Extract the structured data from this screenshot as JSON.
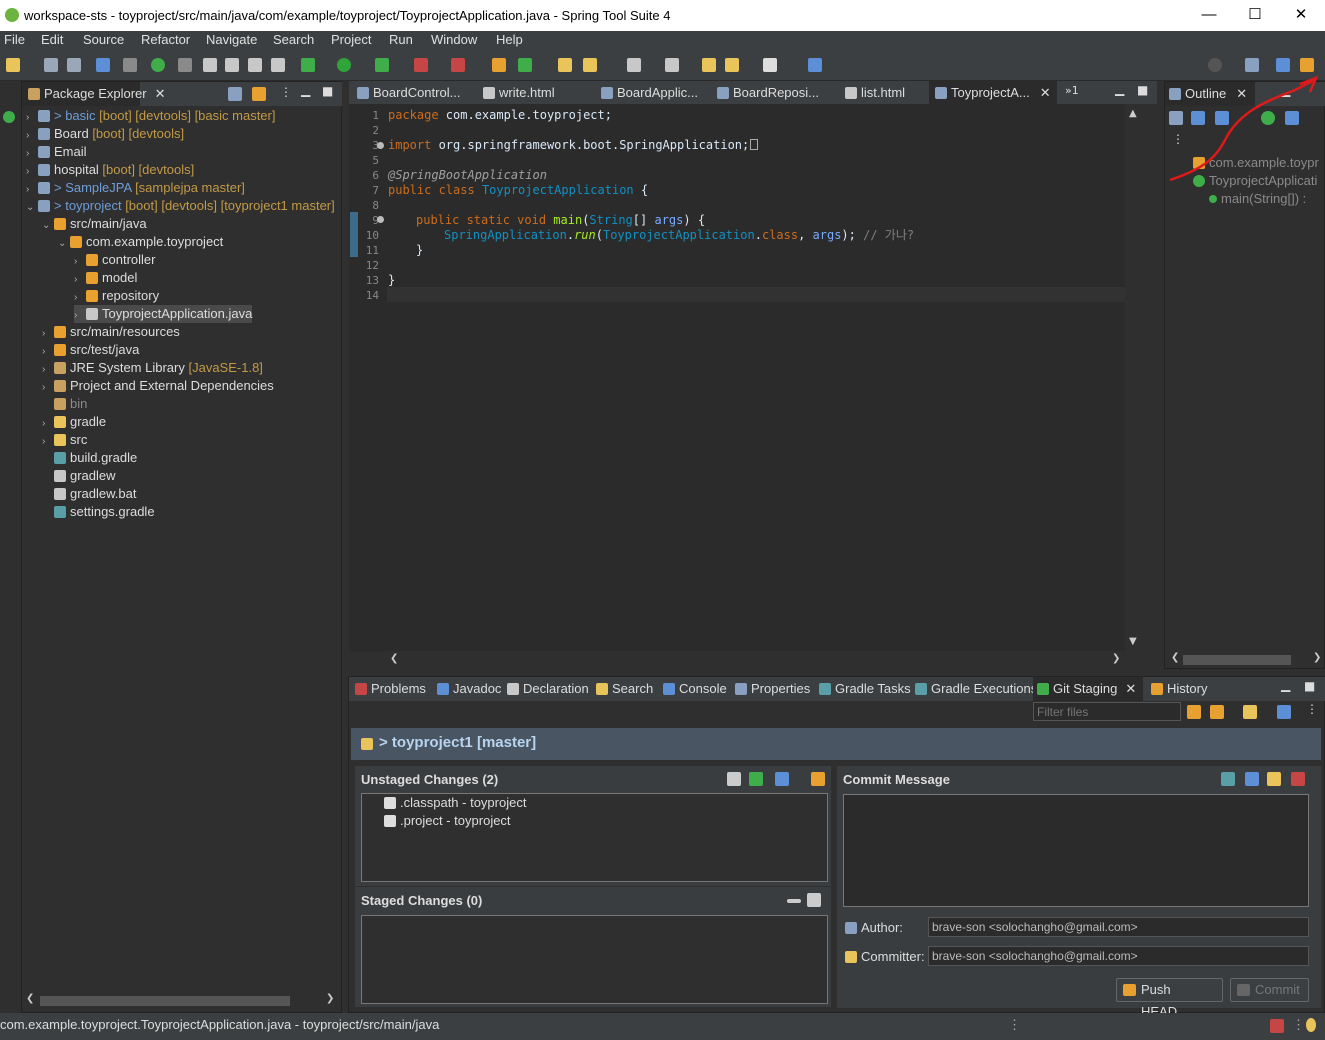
{
  "window": {
    "title": "workspace-sts - toyproject/src/main/java/com/example/toyproject/ToyprojectApplication.java - Spring Tool Suite 4",
    "minimize": "—",
    "maximize": "☐",
    "close": "✕"
  },
  "menu": [
    "File",
    "Edit",
    "Source",
    "Refactor",
    "Navigate",
    "Search",
    "Project",
    "Run",
    "Window",
    "Help"
  ],
  "package_explorer": {
    "tab": "Package Explorer",
    "items": [
      {
        "arrow": "›",
        "text": "> basic",
        "deco": " [boot] [devtools] [basic master]"
      },
      {
        "arrow": "›",
        "text": "Board",
        "deco": " [boot] [devtools]"
      },
      {
        "arrow": "›",
        "text": "Email",
        "deco": ""
      },
      {
        "arrow": "›",
        "text": "hospital",
        "deco": " [boot] [devtools]"
      },
      {
        "arrow": "›",
        "text": "> SampleJPA",
        "deco": " [samplejpa master]"
      },
      {
        "arrow": "⌄",
        "text": "> toyproject",
        "deco": " [boot] [devtools] [toyproject1 master]"
      },
      {
        "arrow": "⌄",
        "text": "src/main/java",
        "deco": ""
      },
      {
        "arrow": "⌄",
        "text": "com.example.toyproject",
        "deco": ""
      },
      {
        "arrow": "›",
        "text": "controller",
        "deco": ""
      },
      {
        "arrow": "›",
        "text": "model",
        "deco": ""
      },
      {
        "arrow": "›",
        "text": "repository",
        "deco": ""
      },
      {
        "arrow": "›",
        "text": "ToyprojectApplication.java",
        "deco": ""
      },
      {
        "arrow": "›",
        "text": "src/main/resources",
        "deco": ""
      },
      {
        "arrow": "›",
        "text": "src/test/java",
        "deco": ""
      },
      {
        "arrow": "›",
        "text": "JRE System Library",
        "deco": " [JavaSE-1.8]"
      },
      {
        "arrow": "›",
        "text": "Project and External Dependencies",
        "deco": ""
      },
      {
        "arrow": "",
        "text": "bin",
        "deco": ""
      },
      {
        "arrow": "›",
        "text": "gradle",
        "deco": ""
      },
      {
        "arrow": "›",
        "text": "src",
        "deco": ""
      },
      {
        "arrow": "",
        "text": "build.gradle",
        "deco": ""
      },
      {
        "arrow": "",
        "text": "gradlew",
        "deco": ""
      },
      {
        "arrow": "",
        "text": "gradlew.bat",
        "deco": ""
      },
      {
        "arrow": "",
        "text": "settings.gradle",
        "deco": ""
      }
    ]
  },
  "editor_tabs": [
    "BoardControl...",
    "write.html",
    "BoardApplic...",
    "BoardReposi...",
    "list.html",
    "ToyprojectA..."
  ],
  "editor_overflow": "»1",
  "code": {
    "line_numbers": [
      "1",
      "2",
      "3",
      "5",
      "6",
      "7",
      "8",
      "9",
      "10",
      "11",
      "12",
      "13",
      "14"
    ],
    "l1_kw": "package",
    "l1_rest": " com.example.toyproject;",
    "l3_kw": "import",
    "l3_rest": " org.springframework.boot.SpringApplication;",
    "l6": "@SpringBootApplication",
    "l7_kw": "public class",
    "l7_type": "ToyprojectApplication",
    "l7_rest": " {",
    "l9_kw": "public static void",
    "l9_mt": "main",
    "l9_p1": "(",
    "l9_ty": "String",
    "l9_p2": "[] ",
    "l9_vr": "args",
    "l9_p3": ") {",
    "l10_ty": "SpringApplication",
    "l10_dot": ".",
    "l10_mt": "run",
    "l10_p1": "(",
    "l10_ty2": "ToyprojectApplication",
    "l10_dot2": ".",
    "l10_kw": "class",
    "l10_p2": ", ",
    "l10_vr": "args",
    "l10_p3": "); ",
    "l10_cm": "// 가나?",
    "l11": "}",
    "l13": "}"
  },
  "outline": {
    "tab": "Outline",
    "items": [
      "com.example.toypr",
      "ToyprojectApplicati",
      "main(String[]) : "
    ]
  },
  "bottom_tabs": [
    "Problems",
    "Javadoc",
    "Declaration",
    "Search",
    "Console",
    "Properties",
    "Gradle Tasks",
    "Gradle Executions",
    "Git Staging",
    "History"
  ],
  "git_staging": {
    "filter_placeholder": "Filter files",
    "repo": "> toyproject1 [master]",
    "unstaged_title": "Unstaged Changes (2)",
    "unstaged_files": [
      ".classpath - toyproject",
      ".project - toyproject"
    ],
    "staged_title": "Staged Changes (0)",
    "commit_title": "Commit Message",
    "author_label": "Author:",
    "author_value": "brave-son <solochangho@gmail.com>",
    "committer_label": "Committer:",
    "committer_value": "brave-son <solochangho@gmail.com>",
    "push_button": "Push HEAD...",
    "commit_button": "Commit"
  },
  "status_bar": {
    "text": "com.example.toyproject.ToyprojectApplication.java - toyproject/src/main/java"
  },
  "colors": {
    "accent": "#6db33f",
    "annotation": "#e01a1a"
  }
}
